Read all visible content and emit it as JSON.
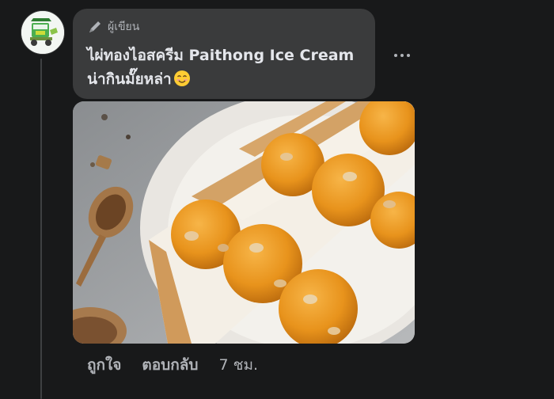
{
  "comment": {
    "author_badge": "ผู้เขียน",
    "text_line1": "ไผ่ทองไอสครีม Paithong Ice Cream",
    "text_line2": "น่ากินมั๊ยหล่า",
    "emoji": "smiling-face-emoji",
    "more_icon": "more-horizontal-icon"
  },
  "photo": {
    "subject": "ice-cream-sandwich-photo"
  },
  "actions": {
    "like_label": "ถูกใจ",
    "reply_label": "ตอบกลับ",
    "timestamp": "7 ชม."
  },
  "colors": {
    "background": "#18191a",
    "bubble": "#3a3b3c",
    "text_primary": "#e4e6eb",
    "text_secondary": "#b0b3b8"
  }
}
